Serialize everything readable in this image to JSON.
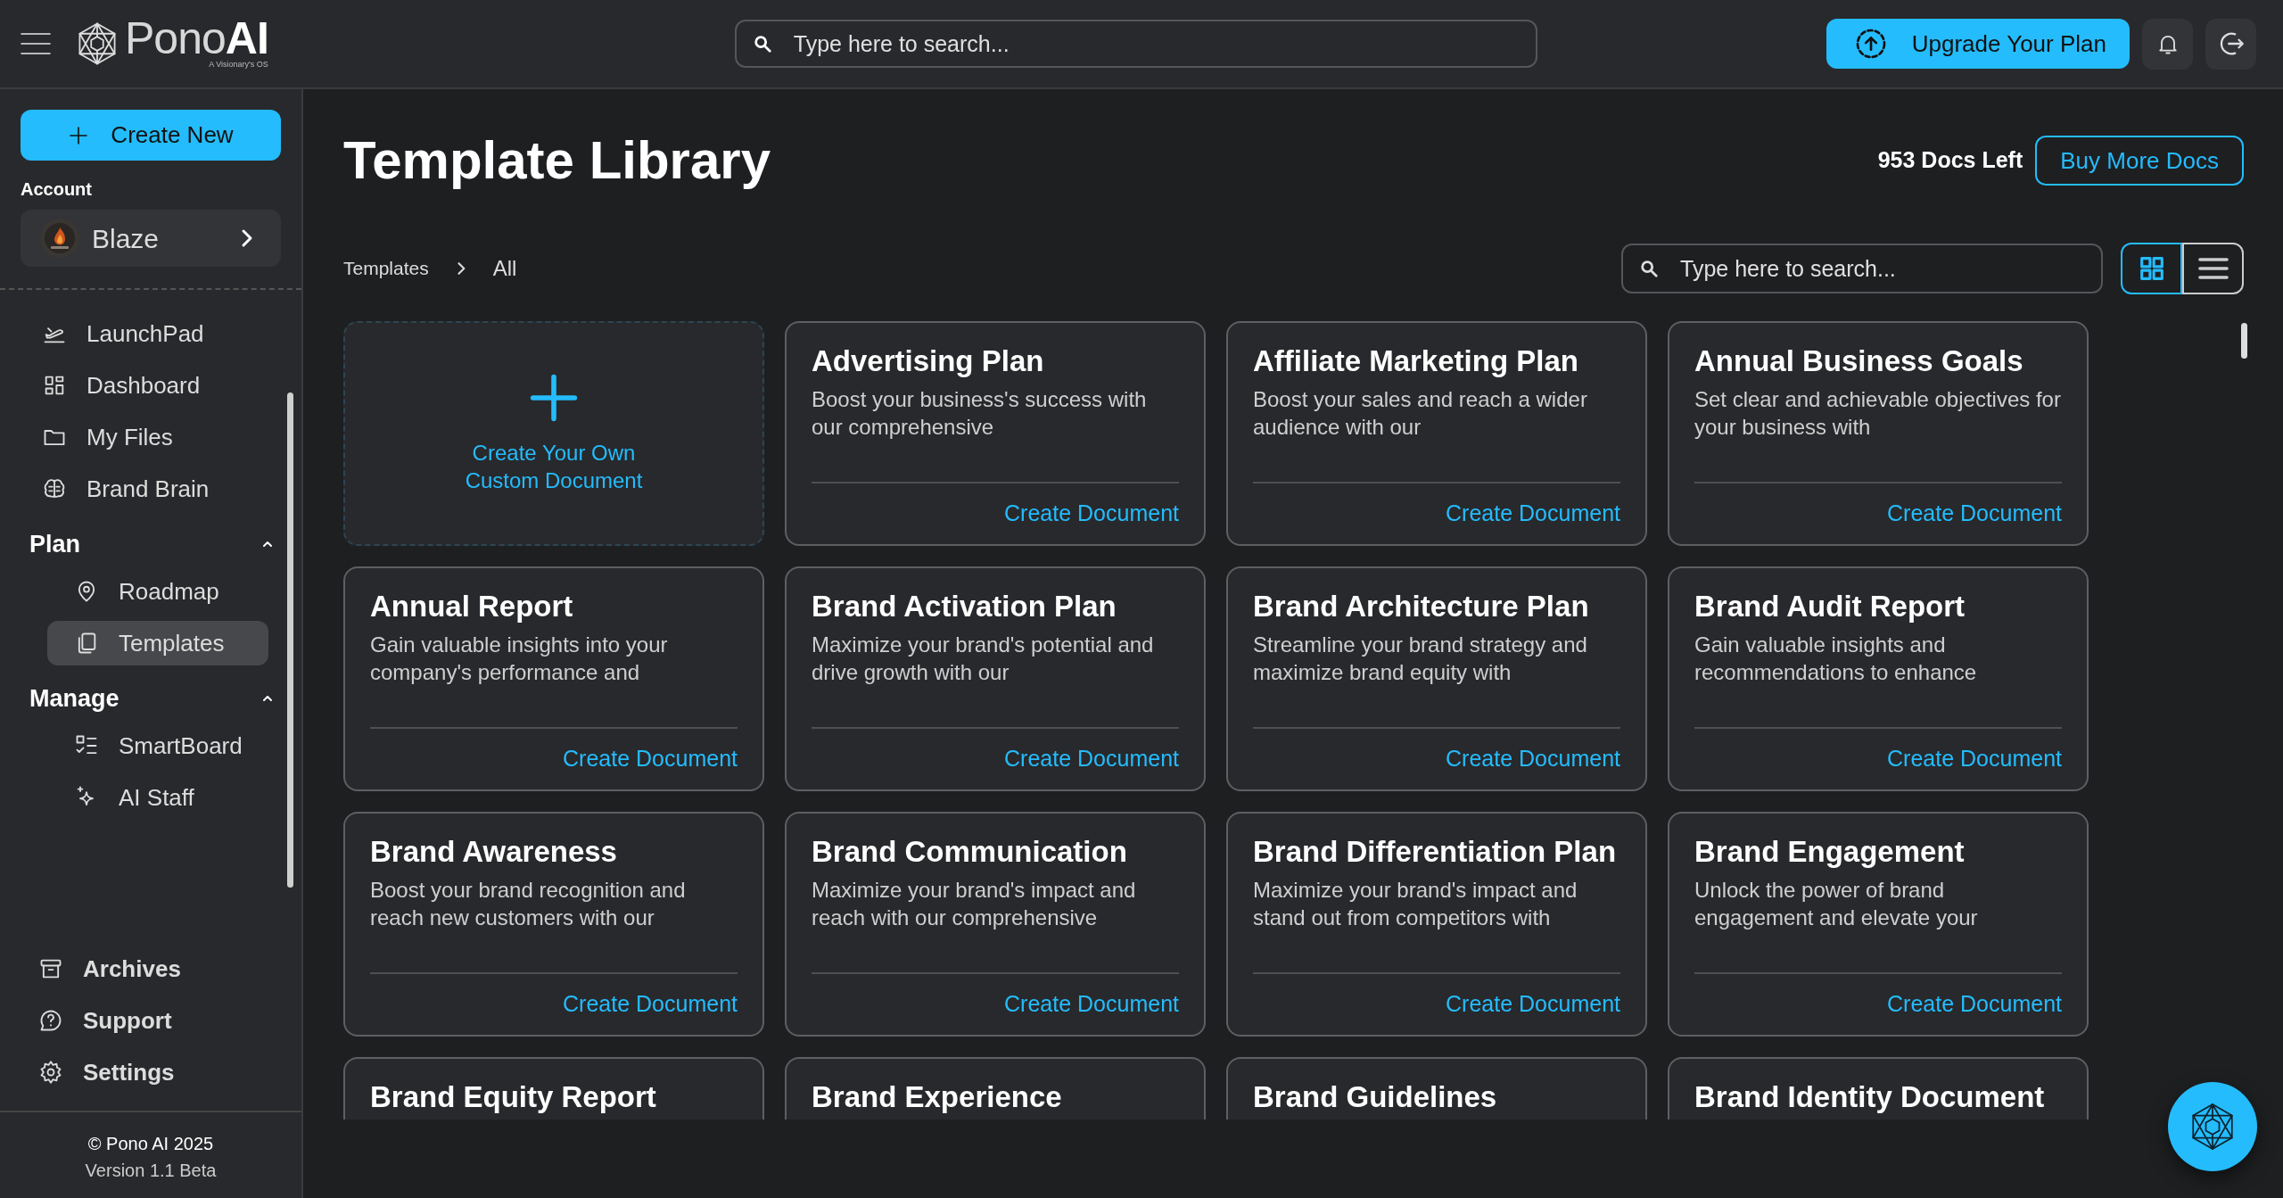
{
  "header": {
    "brand": "Pono**AI**",
    "tagline": "A Visionary's OS",
    "search": {
      "placeholder": "Type here to search..."
    },
    "upgrade_button": "Upgrade Your Plan"
  },
  "sidebar": {
    "create_button": "Create New",
    "account_label": "Account",
    "account": {
      "name": "Blaze"
    },
    "nav": [
      {
        "label": "LaunchPad",
        "selected": false
      },
      {
        "label": "Dashboard",
        "selected": false
      },
      {
        "label": "My Files",
        "selected": false
      },
      {
        "label": "Brand Brain",
        "selected": false
      }
    ],
    "sections": [
      {
        "title": "Plan",
        "expanded": true,
        "items": [
          {
            "label": "Roadmap",
            "selected": false
          },
          {
            "label": "Templates",
            "selected": true
          }
        ]
      },
      {
        "title": "Manage",
        "expanded": true,
        "items": [
          {
            "label": "SmartBoard",
            "selected": false
          },
          {
            "label": "AI Staff",
            "selected": false
          }
        ]
      }
    ],
    "bottom": [
      {
        "label": "Archives"
      },
      {
        "label": "Support"
      },
      {
        "label": "Settings"
      }
    ],
    "footer": {
      "copyright": "© Pono AI 2025",
      "version": "Version 1.1 Beta"
    }
  },
  "main": {
    "title": "Template Library",
    "docs_left": "953 Docs Left",
    "buy_button": "Buy More Docs",
    "breadcrumb": [
      "Templates",
      "All"
    ],
    "search": {
      "placeholder": "Type here to search..."
    },
    "view_toggle": [
      {
        "kind": "grid",
        "selected": true
      },
      {
        "kind": "list",
        "selected": false
      }
    ],
    "templates": [
      {
        "kind": "custom",
        "title": "Create Your Own Custom Document"
      },
      {
        "kind": "template",
        "title": "Advertising Plan",
        "description": "Boost your business's success with our comprehensive",
        "action": "Create Document"
      },
      {
        "kind": "template",
        "title": "Affiliate Marketing Plan",
        "description": "Boost your sales and reach a wider audience with our",
        "action": "Create Document"
      },
      {
        "kind": "template",
        "title": "Annual Business Goals",
        "description": "Set clear and achievable objectives for your business with",
        "action": "Create Document"
      },
      {
        "kind": "template",
        "title": "Annual Report",
        "description": "Gain valuable insights into your company's performance and",
        "action": "Create Document"
      },
      {
        "kind": "template",
        "title": "Brand Activation Plan",
        "description": "Maximize your brand's potential and drive growth with our",
        "action": "Create Document"
      },
      {
        "kind": "template",
        "title": "Brand Architecture Plan",
        "description": "Streamline your brand strategy and maximize brand equity with",
        "action": "Create Document"
      },
      {
        "kind": "template",
        "title": "Brand Audit Report",
        "description": "Gain valuable insights and recommendations to enhance",
        "action": "Create Document"
      },
      {
        "kind": "template",
        "title": "Brand Awareness",
        "description": "Boost your brand recognition and reach new customers with our",
        "action": "Create Document"
      },
      {
        "kind": "template",
        "title": "Brand Communication",
        "description": "Maximize your brand's impact and reach with our comprehensive",
        "action": "Create Document"
      },
      {
        "kind": "template",
        "title": "Brand Differentiation Plan",
        "description": "Maximize your brand's impact and stand out from competitors with",
        "action": "Create Document"
      },
      {
        "kind": "template",
        "title": "Brand Engagement",
        "description": "Unlock the power of brand engagement and elevate your",
        "action": "Create Document"
      },
      {
        "kind": "template",
        "title": "Brand Equity Report"
      },
      {
        "kind": "template",
        "title": "Brand Experience"
      },
      {
        "kind": "template",
        "title": "Brand Guidelines"
      },
      {
        "kind": "template",
        "title": "Brand Identity Document"
      }
    ]
  }
}
